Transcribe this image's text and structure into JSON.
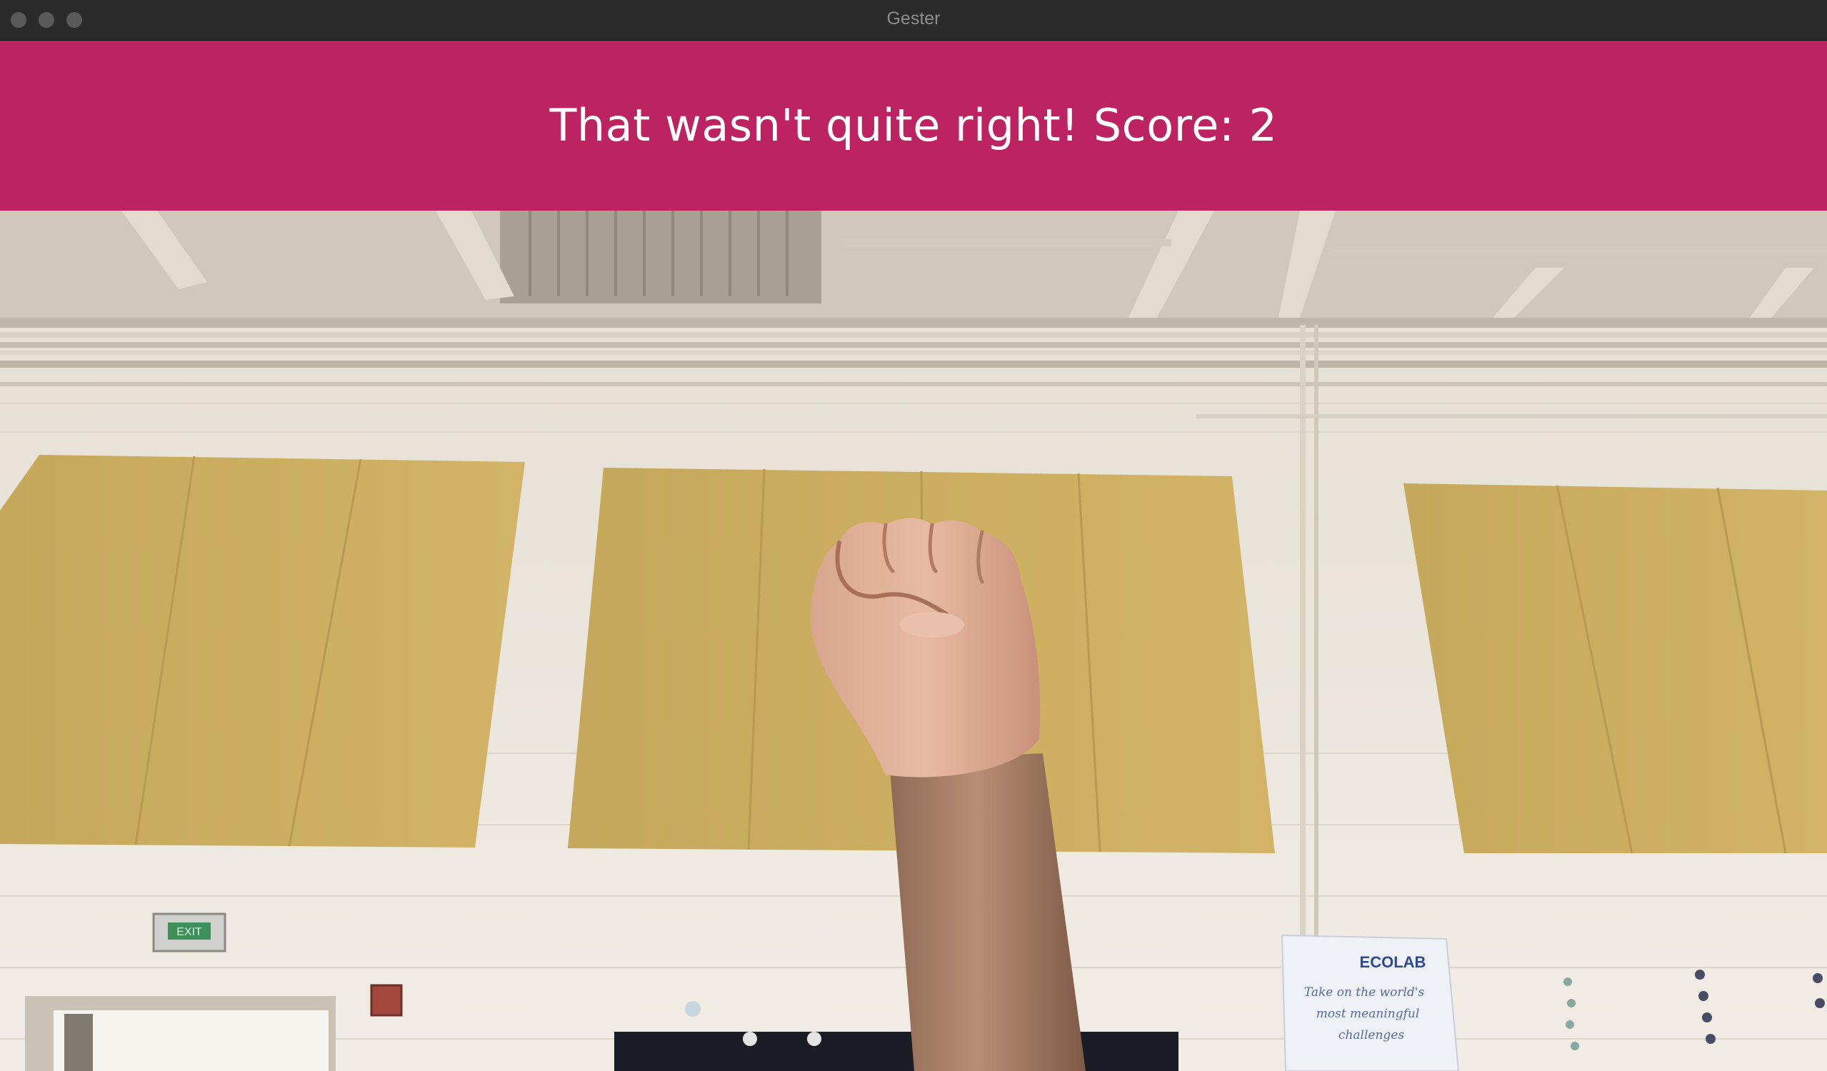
{
  "window": {
    "title": "Gester"
  },
  "banner": {
    "message": "That wasn't quite right! Score: 2",
    "background_color": "#bd2261",
    "text_color": "#ffffff"
  },
  "camera_feed": {
    "gesture": "fist",
    "exit_sign_text": "EXIT",
    "poster": {
      "brand": "ECOLAB",
      "line1": "Take on the world's",
      "line2": "most meaningful",
      "line3": "challenges"
    }
  }
}
